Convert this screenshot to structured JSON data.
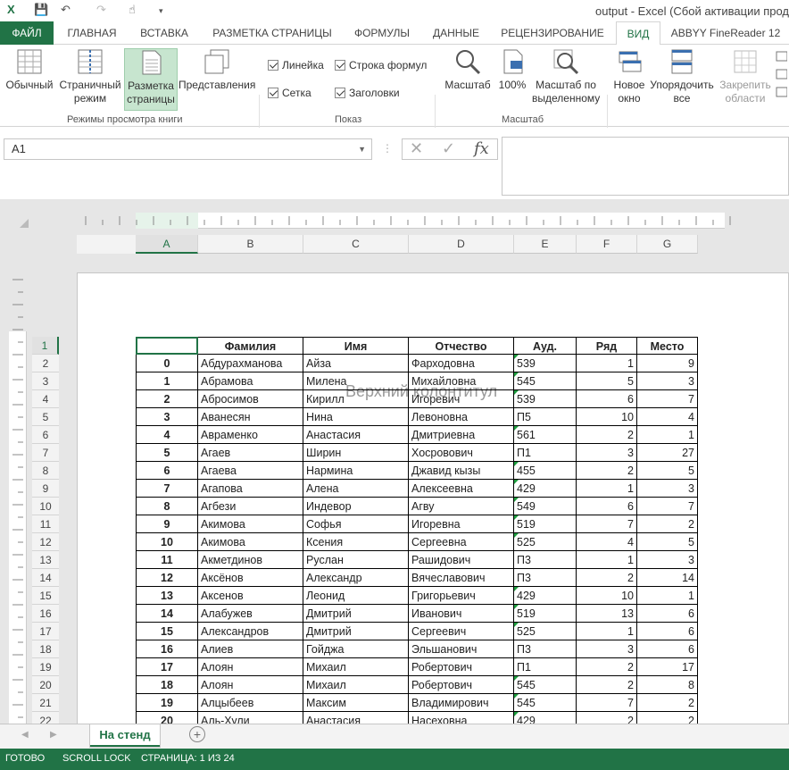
{
  "titlebar": {
    "title": "output - Excel (Сбой активации прод"
  },
  "tabs": [
    "ФАЙЛ",
    "ГЛАВНАЯ",
    "ВСТАВКА",
    "РАЗМЕТКА СТРАНИЦЫ",
    "ФОРМУЛЫ",
    "ДАННЫЕ",
    "РЕЦЕНЗИРОВАНИЕ",
    "ВИД",
    "ABBYY FineReader 12"
  ],
  "ribbon": {
    "views": {
      "normal": "Обычный",
      "pagebreak1": "Страничный",
      "pagebreak2": "режим",
      "layout1": "Разметка",
      "layout2": "страницы",
      "custom": "Представления",
      "group": "Режимы просмотра книги"
    },
    "show": {
      "ruler": "Линейка",
      "formulabar": "Строка формул",
      "grid": "Сетка",
      "headings": "Заголовки",
      "group": "Показ"
    },
    "zoom": {
      "zoom": "Масштаб",
      "hundred": "100%",
      "sel1": "Масштаб по",
      "sel2": "выделенному",
      "group": "Масштаб"
    },
    "window": {
      "new1": "Новое",
      "new2": "окно",
      "arrange1": "Упорядочить",
      "arrange2": "все",
      "freeze1": "Закрепить",
      "freeze2": "области"
    }
  },
  "namebox": "A1",
  "columns": [
    "A",
    "B",
    "C",
    "D",
    "E",
    "F",
    "G"
  ],
  "header_footer_placeholder": "Верхний колонтитул",
  "table": {
    "headers": [
      "",
      "Фамилия",
      "Имя",
      "Отчество",
      "Ауд.",
      "Ряд",
      "Место"
    ],
    "rows": [
      [
        "0",
        "Абдурахманова",
        "Айза",
        "Фарходовна",
        "539",
        "1",
        "9"
      ],
      [
        "1",
        "Абрамова",
        "Милена",
        "Михайловна",
        "545",
        "5",
        "3"
      ],
      [
        "2",
        "Абросимов",
        "Кирилл",
        "Игоревич",
        "539",
        "6",
        "7"
      ],
      [
        "3",
        "Аванесян",
        "Нина",
        "Левоновна",
        "П5",
        "10",
        "4"
      ],
      [
        "4",
        "Авраменко",
        "Анастасия",
        "Дмитриевна",
        "561",
        "2",
        "1"
      ],
      [
        "5",
        "Агаев",
        "Ширин",
        "Хосровович",
        "П1",
        "3",
        "27"
      ],
      [
        "6",
        "Агаева",
        "Нармина",
        "Джавид кызы",
        "455",
        "2",
        "5"
      ],
      [
        "7",
        "Агапова",
        "Алена",
        "Алексеевна",
        "429",
        "1",
        "3"
      ],
      [
        "8",
        "Агбези",
        "Индевор",
        "Агву",
        "549",
        "6",
        "7"
      ],
      [
        "9",
        "Акимова",
        "Софья",
        "Игоревна",
        "519",
        "7",
        "2"
      ],
      [
        "10",
        "Акимова",
        "Ксения",
        "Сергеевна",
        "525",
        "4",
        "5"
      ],
      [
        "11",
        "Акметдинов",
        "Руслан",
        "Рашидович",
        "П3",
        "1",
        "3"
      ],
      [
        "12",
        "Аксёнов",
        "Александр",
        "Вячеславович",
        "П3",
        "2",
        "14"
      ],
      [
        "13",
        "Аксенов",
        "Леонид",
        "Григорьевич",
        "429",
        "10",
        "1"
      ],
      [
        "14",
        "Алабужев",
        "Дмитрий",
        "Иванович",
        "519",
        "13",
        "6"
      ],
      [
        "15",
        "Александров",
        "Дмитрий",
        "Сергеевич",
        "525",
        "1",
        "6"
      ],
      [
        "16",
        "Алиев",
        "Гойджа",
        "Эльшанович",
        "П3",
        "3",
        "6"
      ],
      [
        "17",
        "Алоян",
        "Михаил",
        "Робертович",
        "П1",
        "2",
        "17"
      ],
      [
        "18",
        "Алоян",
        "Михаил",
        "Робертович",
        "545",
        "2",
        "8"
      ],
      [
        "19",
        "Алцыбеев",
        "Максим",
        "Владимирович",
        "545",
        "7",
        "2"
      ],
      [
        "20",
        "Аль-Хули",
        "Анастасия",
        "Насеховна",
        "429",
        "2",
        "2"
      ]
    ]
  },
  "sheet_tab": "На стенд",
  "status": {
    "ready": "ГОТОВО",
    "scroll": "SCROLL LOCK",
    "page": "СТРАНИЦА: 1 ИЗ 24"
  },
  "colors": {
    "accent": "#217346",
    "marker": "#1e9d3f"
  }
}
